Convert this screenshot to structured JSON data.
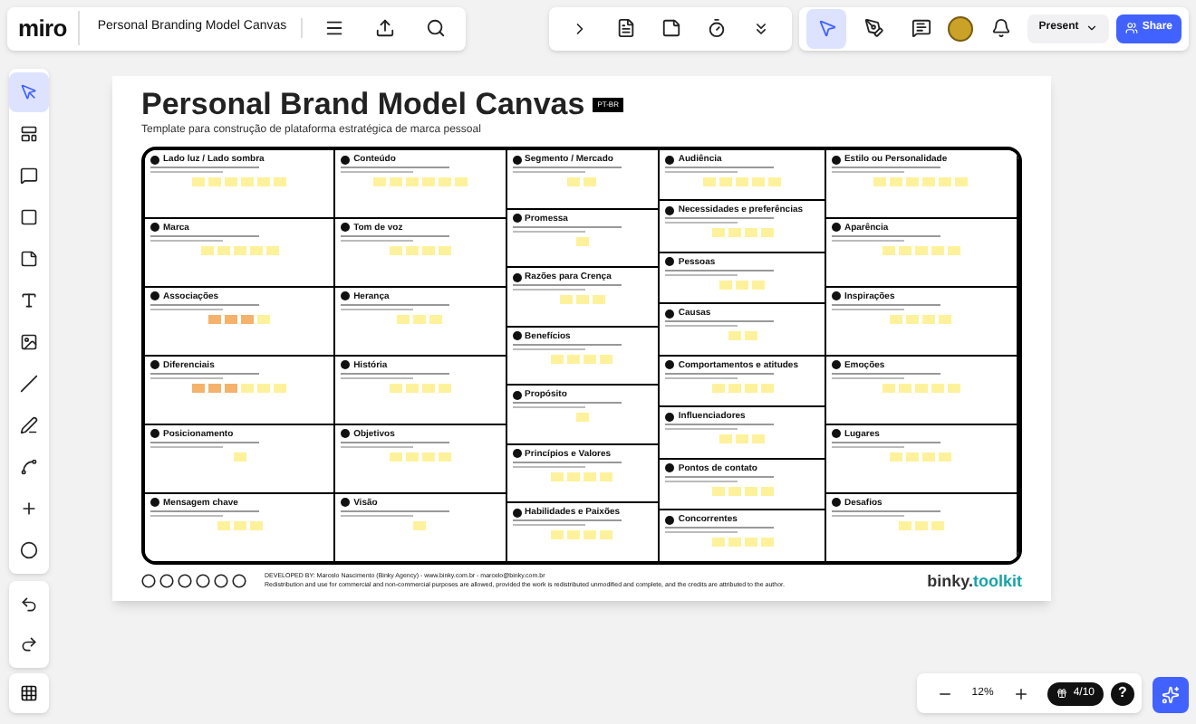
{
  "topbar": {
    "logo": "miro",
    "board_name": "Personal Branding Model Canvas",
    "present": "Present",
    "share": "Share"
  },
  "board": {
    "title": "Personal Brand Model Canvas",
    "badge": "PT-BR",
    "subtitle": "Template para construção de plataforma estratégica de marca pessoal",
    "columns": [
      {
        "cells": [
          {
            "title": "Lado luz / Lado sombra",
            "notes": [
              {
                "color": "#fdf29b"
              },
              {
                "color": "#fdf29b"
              },
              {
                "color": "#fdf29b"
              },
              {
                "color": "#fdf29b"
              },
              {
                "color": "#fdf29b"
              },
              {
                "color": "#fdf29b"
              }
            ]
          },
          {
            "title": "Marca",
            "notes": [
              {
                "color": "#fdf29b"
              },
              {
                "color": "#fdf29b"
              },
              {
                "color": "#fdf29b"
              },
              {
                "color": "#fdf29b"
              },
              {
                "color": "#fdf29b"
              }
            ]
          },
          {
            "title": "Associações",
            "notes": [
              {
                "color": "#f4b26b"
              },
              {
                "color": "#f4b26b"
              },
              {
                "color": "#f4b26b"
              },
              {
                "color": "#fdf29b"
              }
            ]
          },
          {
            "title": "Diferenciais",
            "notes": [
              {
                "color": "#f4b26b"
              },
              {
                "color": "#f4b26b"
              },
              {
                "color": "#f4b26b"
              },
              {
                "color": "#fdf29b"
              },
              {
                "color": "#fdf29b"
              },
              {
                "color": "#fdf29b"
              }
            ]
          },
          {
            "title": "Posicionamento",
            "notes": [
              {
                "color": "#fdf29b"
              }
            ]
          },
          {
            "title": "Mensagem chave",
            "notes": [
              {
                "color": "#fdf29b"
              },
              {
                "color": "#fdf29b"
              },
              {
                "color": "#fdf29b"
              }
            ]
          }
        ]
      },
      {
        "cells": [
          {
            "title": "Conteúdo",
            "notes": [
              {
                "color": "#fdf29b"
              },
              {
                "color": "#fdf29b"
              },
              {
                "color": "#fdf29b"
              },
              {
                "color": "#fdf29b"
              },
              {
                "color": "#fdf29b"
              },
              {
                "color": "#fdf29b"
              }
            ]
          },
          {
            "title": "Tom de voz",
            "notes": [
              {
                "color": "#fdf29b"
              },
              {
                "color": "#fdf29b"
              },
              {
                "color": "#fdf29b"
              },
              {
                "color": "#fdf29b"
              }
            ]
          },
          {
            "title": "Herança",
            "notes": [
              {
                "color": "#fdf29b"
              },
              {
                "color": "#fdf29b"
              },
              {
                "color": "#fdf29b"
              }
            ]
          },
          {
            "title": "História",
            "notes": [
              {
                "color": "#fdf29b"
              },
              {
                "color": "#fdf29b"
              },
              {
                "color": "#fdf29b"
              },
              {
                "color": "#fdf29b"
              }
            ]
          },
          {
            "title": "Objetivos",
            "notes": [
              {
                "color": "#fdf29b"
              },
              {
                "color": "#fdf29b"
              },
              {
                "color": "#fdf29b"
              },
              {
                "color": "#fdf29b"
              }
            ]
          },
          {
            "title": "Visão",
            "notes": [
              {
                "color": "#fdf29b"
              }
            ]
          }
        ]
      },
      {
        "cells": [
          {
            "title": "Segmento / Mercado",
            "notes": [
              {
                "color": "#fdf29b"
              },
              {
                "color": "#fdf29b"
              }
            ]
          },
          {
            "title": "Promessa",
            "notes": [
              {
                "color": "#fdf29b"
              }
            ]
          },
          {
            "title": "Razões para Crença",
            "notes": [
              {
                "color": "#fdf29b"
              },
              {
                "color": "#fdf29b"
              },
              {
                "color": "#fdf29b"
              }
            ]
          },
          {
            "title": "Benefícios",
            "notes": [
              {
                "color": "#fdf29b"
              },
              {
                "color": "#fdf29b"
              },
              {
                "color": "#fdf29b"
              },
              {
                "color": "#fdf29b"
              }
            ]
          },
          {
            "title": "Propósito",
            "notes": [
              {
                "color": "#fdf29b"
              }
            ]
          },
          {
            "title": "Princípios e Valores",
            "notes": [
              {
                "color": "#fdf29b"
              },
              {
                "color": "#fdf29b"
              },
              {
                "color": "#fdf29b"
              },
              {
                "color": "#fdf29b"
              }
            ]
          },
          {
            "title": "Habilidades e Paixões",
            "notes": [
              {
                "color": "#fdf29b"
              },
              {
                "color": "#fdf29b"
              },
              {
                "color": "#fdf29b"
              },
              {
                "color": "#fdf29b"
              }
            ]
          }
        ]
      },
      {
        "cells": [
          {
            "title": "Audiência",
            "notes": [
              {
                "color": "#fdf29b"
              },
              {
                "color": "#fdf29b"
              },
              {
                "color": "#fdf29b"
              },
              {
                "color": "#fdf29b"
              },
              {
                "color": "#fdf29b"
              }
            ]
          },
          {
            "title": "Necessidades e preferências",
            "notes": [
              {
                "color": "#fdf29b"
              },
              {
                "color": "#fdf29b"
              },
              {
                "color": "#fdf29b"
              },
              {
                "color": "#fdf29b"
              }
            ]
          },
          {
            "title": "Pessoas",
            "notes": [
              {
                "color": "#fdf29b"
              },
              {
                "color": "#fdf29b"
              },
              {
                "color": "#fdf29b"
              }
            ]
          },
          {
            "title": "Causas",
            "notes": [
              {
                "color": "#fdf29b"
              },
              {
                "color": "#fdf29b"
              }
            ]
          },
          {
            "title": "Comportamentos e atitudes",
            "notes": [
              {
                "color": "#fdf29b"
              },
              {
                "color": "#fdf29b"
              },
              {
                "color": "#fdf29b"
              },
              {
                "color": "#fdf29b"
              }
            ]
          },
          {
            "title": "Influenciadores",
            "notes": [
              {
                "color": "#fdf29b"
              },
              {
                "color": "#fdf29b"
              },
              {
                "color": "#fdf29b"
              }
            ]
          },
          {
            "title": "Pontos de contato",
            "notes": [
              {
                "color": "#fdf29b"
              },
              {
                "color": "#fdf29b"
              },
              {
                "color": "#fdf29b"
              },
              {
                "color": "#fdf29b"
              }
            ]
          },
          {
            "title": "Concorrentes",
            "notes": [
              {
                "color": "#fdf29b"
              },
              {
                "color": "#fdf29b"
              },
              {
                "color": "#fdf29b"
              },
              {
                "color": "#fdf29b"
              }
            ]
          }
        ]
      },
      {
        "cells": [
          {
            "title": "Estilo ou Personalidade",
            "notes": [
              {
                "color": "#fdf29b"
              },
              {
                "color": "#fdf29b"
              },
              {
                "color": "#fdf29b"
              },
              {
                "color": "#fdf29b"
              },
              {
                "color": "#fdf29b"
              },
              {
                "color": "#fdf29b"
              }
            ]
          },
          {
            "title": "Aparência",
            "notes": [
              {
                "color": "#fdf29b"
              },
              {
                "color": "#fdf29b"
              },
              {
                "color": "#fdf29b"
              },
              {
                "color": "#fdf29b"
              },
              {
                "color": "#fdf29b"
              }
            ]
          },
          {
            "title": "Inspirações",
            "notes": [
              {
                "color": "#fdf29b"
              },
              {
                "color": "#fdf29b"
              },
              {
                "color": "#fdf29b"
              },
              {
                "color": "#fdf29b"
              }
            ]
          },
          {
            "title": "Emoções",
            "notes": [
              {
                "color": "#fdf29b"
              },
              {
                "color": "#fdf29b"
              },
              {
                "color": "#fdf29b"
              },
              {
                "color": "#fdf29b"
              },
              {
                "color": "#fdf29b"
              }
            ]
          },
          {
            "title": "Lugares",
            "notes": [
              {
                "color": "#fdf29b"
              },
              {
                "color": "#fdf29b"
              },
              {
                "color": "#fdf29b"
              },
              {
                "color": "#fdf29b"
              }
            ]
          },
          {
            "title": "Desafios",
            "notes": [
              {
                "color": "#fdf29b"
              },
              {
                "color": "#fdf29b"
              },
              {
                "color": "#fdf29b"
              }
            ]
          }
        ]
      }
    ],
    "credits": "DEVELOPED BY: Marcelo Nascimento (Binky Agency) - www.binky.com.br - marcelo@binky.com.br",
    "license": "Redistribution and use for commercial and non-commercial purposes are allowed, provided the work is redistributed unmodified and complete, and the credits are attributed to the author.",
    "brand": {
      "part_1": "binky.",
      "part_2": "toolkit"
    }
  },
  "zoom": {
    "value": "12%"
  },
  "frames_badge": "4/10",
  "help": "?"
}
